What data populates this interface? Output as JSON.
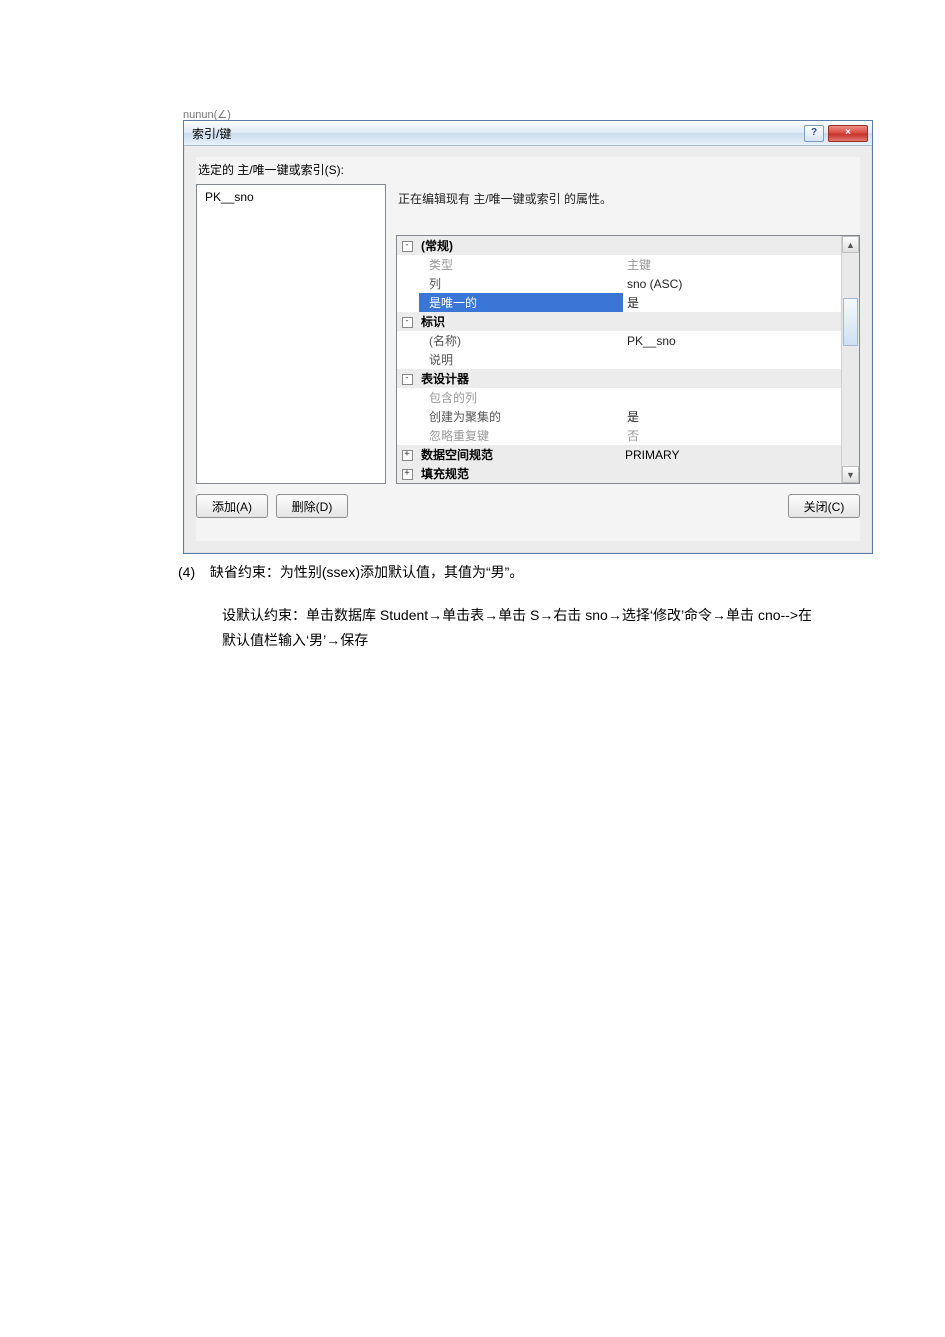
{
  "dialog": {
    "title": "索引/键",
    "help_glyph": "?",
    "close_glyph": "×",
    "list_label": "选定的 主/唯一键或索引(S):",
    "list_items": [
      "PK__sno"
    ],
    "description": "正在编辑现有 主/唯一键或索引 的属性。",
    "buttons": {
      "add": "添加(A)",
      "delete": "删除(D)",
      "close": "关闭(C)"
    },
    "categories": {
      "general": "(常规)",
      "identity": "标识",
      "designer": "表设计器",
      "dataspace": "数据空间规范",
      "fill": "填充规范"
    },
    "props": {
      "type_label": "类型",
      "type_value": "主键",
      "columns_label": "列",
      "columns_value": "sno (ASC)",
      "is_unique_label": "是唯一的",
      "is_unique_value": "是",
      "name_label": "(名称)",
      "name_value": "PK__sno",
      "desc_label": "说明",
      "desc_value": "",
      "included_label": "包含的列",
      "included_value": "",
      "clustered_label": "创建为聚集的",
      "clustered_value": "是",
      "ignore_dup_label": "忽略重复键",
      "ignore_dup_value": "否",
      "dataspace_value": "PRIMARY"
    },
    "expand_minus": "-",
    "expand_plus": "+",
    "scroll_up": "▲",
    "scroll_down": "▼"
  },
  "doc": {
    "fragment_above": "nunun(∠)",
    "item_number": "(4)",
    "item_text": "缺省约束：为性别(ssex)添加默认值，其值为“男”。",
    "procedure": "设默认约束：单击数据库 Student→单击表→单击 S→右击 sno→选择‘修改’命令→单击 cno-->在默认值栏输入‘男’→保存"
  }
}
